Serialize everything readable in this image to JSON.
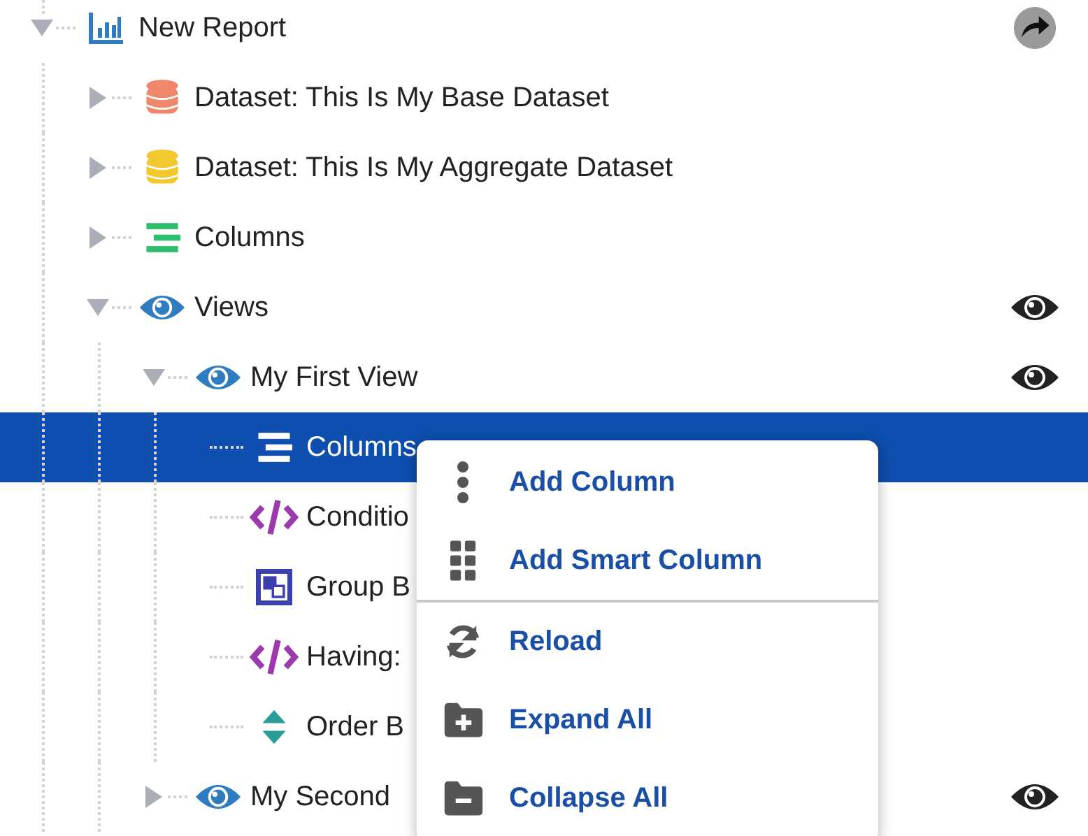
{
  "tree": [
    {
      "label": "New Report",
      "kind": "report",
      "expanded": true,
      "action": {
        "kind": "share"
      },
      "children": [
        {
          "label": "Dataset: This Is My Base Dataset",
          "kind": "database",
          "color": "#f0876a",
          "expanded": false
        },
        {
          "label": "Dataset: This Is My Aggregate Dataset",
          "kind": "database",
          "color": "#f2c82f",
          "expanded": false
        },
        {
          "label": "Columns",
          "kind": "columns",
          "expanded": false
        },
        {
          "label": "Views",
          "kind": "eye",
          "expanded": true,
          "action": {
            "kind": "eye"
          },
          "children": [
            {
              "label": "My First View",
              "kind": "eye",
              "expanded": true,
              "action": {
                "kind": "eye"
              },
              "children": [
                {
                  "label": "Columns",
                  "kind": "columns",
                  "selected": true
                },
                {
                  "label": "Conditio",
                  "kind": "code",
                  "selected": false
                },
                {
                  "label": "Group B",
                  "kind": "group",
                  "selected": false
                },
                {
                  "label": "Having:",
                  "kind": "code",
                  "selected": false
                },
                {
                  "label": "Order B",
                  "kind": "sort",
                  "selected": false
                }
              ]
            },
            {
              "label": "My Second",
              "kind": "eye",
              "expanded": false,
              "action": {
                "kind": "eye"
              }
            }
          ]
        }
      ]
    }
  ],
  "context_menu": {
    "items": [
      {
        "label": "Add Column",
        "kind": "dots"
      },
      {
        "label": "Add Smart Column",
        "kind": "grid",
        "divider_after": true
      },
      {
        "label": "Reload",
        "kind": "reload"
      },
      {
        "label": "Expand All",
        "kind": "folder-plus"
      },
      {
        "label": "Collapse All",
        "kind": "folder-minus"
      }
    ]
  }
}
